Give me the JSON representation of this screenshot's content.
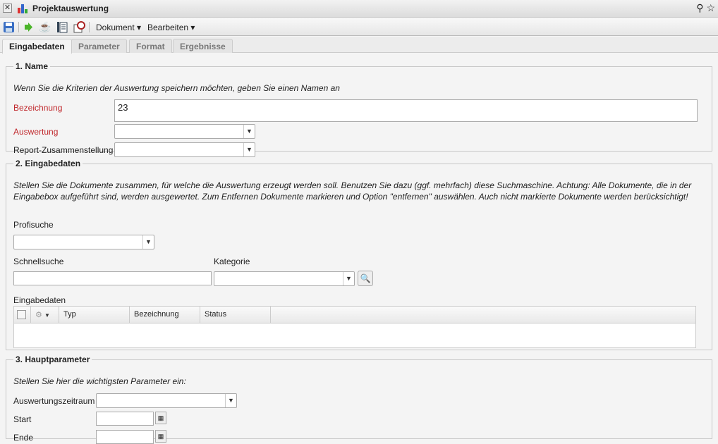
{
  "window": {
    "title": "Projektauswertung",
    "close_icon": "close-icon",
    "app_icon": "bar-chart-icon"
  },
  "toolbar": {
    "menus": [
      "Dokument",
      "Bearbeiten"
    ]
  },
  "tabs": [
    "Eingabedaten",
    "Parameter",
    "Format",
    "Ergebnisse"
  ],
  "section1": {
    "legend": "1. Name",
    "hint": "Wenn Sie die Kriterien der Auswertung speichern möchten, geben Sie einen Namen an",
    "bezeichnung_label": "Bezeichnung",
    "bezeichnung_value": "23",
    "auswertung_label": "Auswertung",
    "report_label": "Report-Zusammenstellung"
  },
  "section2": {
    "legend": "2. Eingabedaten",
    "hint": "Stellen Sie die Dokumente zusammen, für welche die Auswertung erzeugt werden soll. Benutzen Sie dazu (ggf. mehrfach) diese Suchmaschine. Achtung: Alle Dokumente, die in der Eingabebox aufgeführt sind, werden ausgewertet. Zum Entfernen Dokumente markieren und Option \"entfernen\" auswählen. Auch nicht markierte Dokumente werden berücksichtigt!",
    "profisuche_label": "Profisuche",
    "schnellsuche_label": "Schnellsuche",
    "kategorie_label": "Kategorie",
    "eingabedaten_label": "Eingabedaten",
    "columns": [
      "Typ",
      "Bezeichnung",
      "Status"
    ]
  },
  "section3": {
    "legend": "3. Hauptparameter",
    "hint": "Stellen Sie hier die wichtigsten Parameter ein:",
    "zeitraum_label": "Auswertungszeitraum",
    "start_label": "Start",
    "ende_label": "Ende"
  }
}
